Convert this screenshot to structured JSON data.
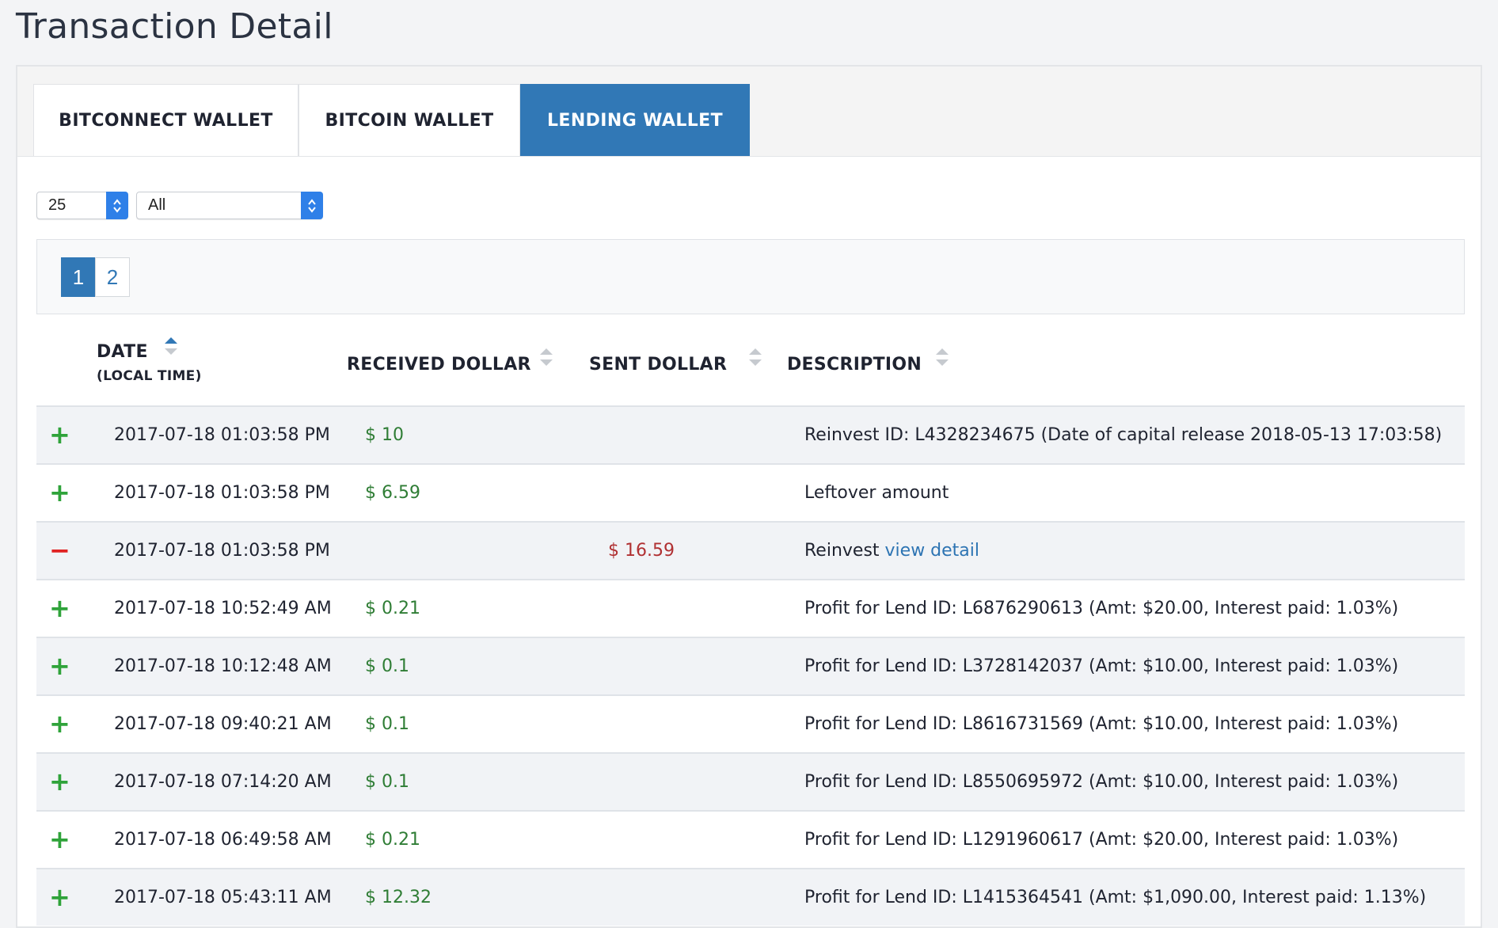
{
  "page_title": "Transaction Detail",
  "tabs": [
    {
      "label": "BITCONNECT WALLET",
      "active": false
    },
    {
      "label": "BITCOIN WALLET",
      "active": false
    },
    {
      "label": "LENDING WALLET",
      "active": true
    }
  ],
  "filters": {
    "page_size": "25",
    "type_filter": "All"
  },
  "pagination": {
    "pages": [
      "1",
      "2"
    ],
    "current": "1"
  },
  "table": {
    "columns": {
      "date": "DATE",
      "date_sub": "(LOCAL TIME)",
      "received": "RECEIVED DOLLAR",
      "sent": "SENT DOLLAR",
      "description": "DESCRIPTION"
    },
    "rows": [
      {
        "sign": "+",
        "date": "2017-07-18 01:03:58 PM",
        "received": "$ 10",
        "sent": "",
        "description": "Reinvest ID: L4328234675 (Date of capital release 2018-05-13 17:03:58)",
        "link": ""
      },
      {
        "sign": "+",
        "date": "2017-07-18 01:03:58 PM",
        "received": "$ 6.59",
        "sent": "",
        "description": "Leftover amount",
        "link": ""
      },
      {
        "sign": "−",
        "date": "2017-07-18 01:03:58 PM",
        "received": "",
        "sent": "$ 16.59",
        "description": "Reinvest ",
        "link": "view detail"
      },
      {
        "sign": "+",
        "date": "2017-07-18 10:52:49 AM",
        "received": "$ 0.21",
        "sent": "",
        "description": "Profit for Lend ID: L6876290613 (Amt: $20.00, Interest paid: 1.03%)",
        "link": ""
      },
      {
        "sign": "+",
        "date": "2017-07-18 10:12:48 AM",
        "received": "$ 0.1",
        "sent": "",
        "description": "Profit for Lend ID: L3728142037 (Amt: $10.00, Interest paid: 1.03%)",
        "link": ""
      },
      {
        "sign": "+",
        "date": "2017-07-18 09:40:21 AM",
        "received": "$ 0.1",
        "sent": "",
        "description": "Profit for Lend ID: L8616731569 (Amt: $10.00, Interest paid: 1.03%)",
        "link": ""
      },
      {
        "sign": "+",
        "date": "2017-07-18 07:14:20 AM",
        "received": "$ 0.1",
        "sent": "",
        "description": "Profit for Lend ID: L8550695972 (Amt: $10.00, Interest paid: 1.03%)",
        "link": ""
      },
      {
        "sign": "+",
        "date": "2017-07-18 06:49:58 AM",
        "received": "$ 0.21",
        "sent": "",
        "description": "Profit for Lend ID: L1291960617 (Amt: $20.00, Interest paid: 1.03%)",
        "link": ""
      },
      {
        "sign": "+",
        "date": "2017-07-18 05:43:11 AM",
        "received": "$ 12.32",
        "sent": "",
        "description": "Profit for Lend ID: L1415364541 (Amt: $1,090.00, Interest paid: 1.13%)",
        "link": ""
      }
    ]
  },
  "colors": {
    "accent": "#3178b6",
    "positive": "#2f7d35",
    "negative": "#b03032",
    "plus_sign": "#2fa33a",
    "minus_sign": "#e02222"
  },
  "icons": {
    "select_arrow": "updown-chevron-icon",
    "sort": "sort-arrows-icon"
  }
}
